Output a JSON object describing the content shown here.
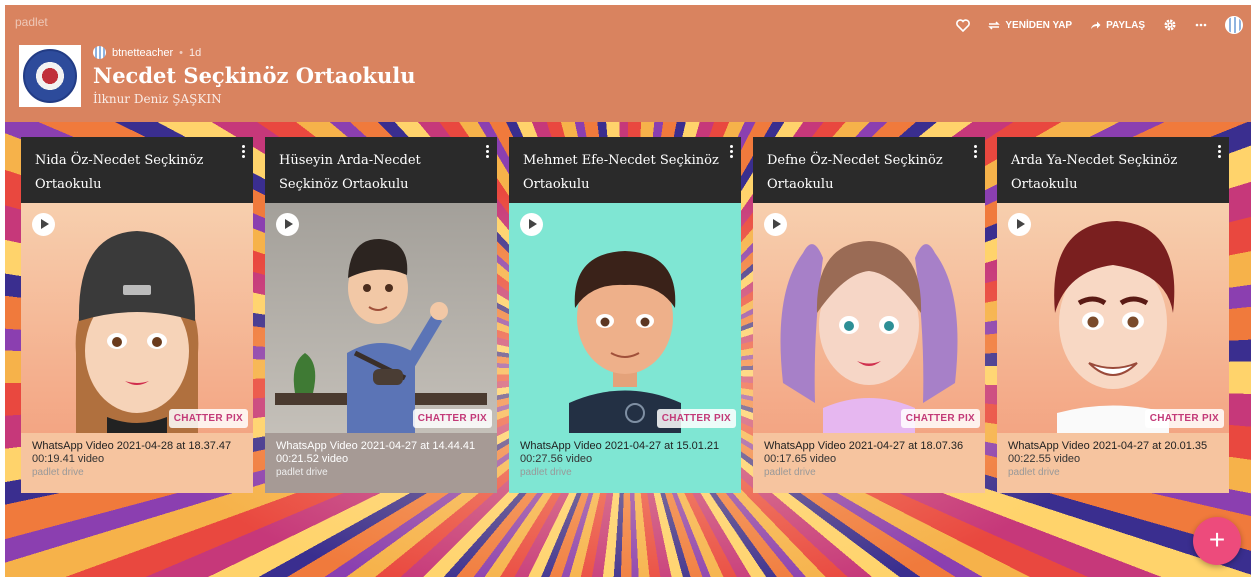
{
  "app": {
    "name": "padlet"
  },
  "toolbar": {
    "favorite_icon": "heart-icon",
    "remake_label": "YENİDEN YAP",
    "share_label": "PAYLAŞ",
    "settings_icon": "gear-icon",
    "more_icon": "ellipsis-icon"
  },
  "board": {
    "author": "btnetteacher",
    "age": "1d",
    "title": "Necdet Seçkinöz Ortaokulu",
    "subtitle": "İlknur Deniz ŞAŞKIN"
  },
  "posts": [
    {
      "title": "Nida Öz-Necdet Seçkinöz Ortaokulu",
      "file": "WhatsApp Video 2021-04-28 at 18.37.47",
      "length": "00:19.41 video",
      "source": "padlet drive",
      "watermark": "CHATTER PIX",
      "bg": "#f6c49f"
    },
    {
      "title": "Hüseyin Arda-Necdet Seçkinöz Ortaokulu",
      "file": "WhatsApp Video 2021-04-27 at 14.44.41",
      "length": "00:21.52 video",
      "source": "padlet drive",
      "watermark": "CHATTER PIX",
      "bg": "#a69a95"
    },
    {
      "title": "Mehmet Efe-Necdet Seçkinöz Ortaokulu",
      "file": "WhatsApp Video 2021-04-27 at 15.01.21",
      "length": "00:27.56 video",
      "source": "padlet drive",
      "watermark": "CHATTER PIX",
      "bg": "#7fe6d3"
    },
    {
      "title": "Defne Öz-Necdet Seçkinöz Ortaokulu",
      "file": "WhatsApp Video 2021-04-27 at 18.07.36",
      "length": "00:17.65 video",
      "source": "padlet drive",
      "watermark": "CHATTER PIX",
      "bg": "#f6c49f"
    },
    {
      "title": "Arda Ya-Necdet Seçkinöz Ortaokulu",
      "file": "WhatsApp Video 2021-04-27 at 20.01.35",
      "length": "00:22.55 video",
      "source": "padlet drive",
      "watermark": "CHATTER PIX",
      "bg": "#f6c49f"
    }
  ],
  "fab": {
    "label": "+"
  },
  "colors": {
    "header": "#d9835f",
    "card_head": "#2a2a2a",
    "fab": "#ed4b7c"
  }
}
